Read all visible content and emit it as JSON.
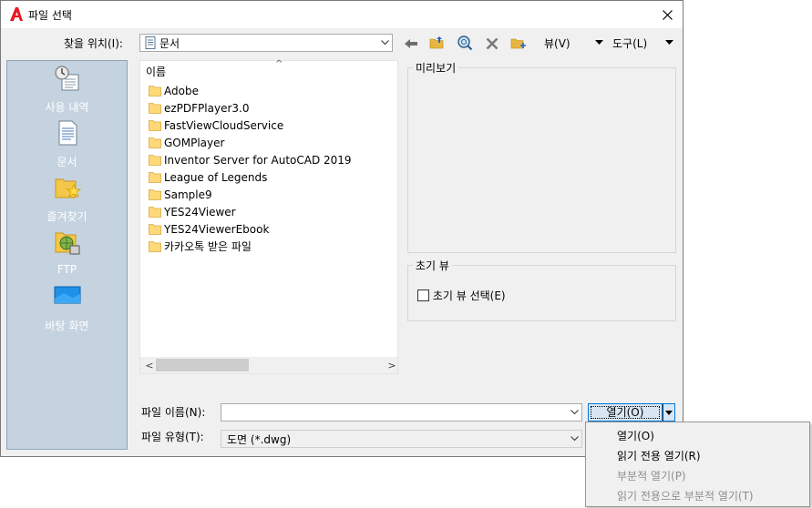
{
  "window": {
    "title": "파일 선택",
    "close_glyph": "✕"
  },
  "toolbar": {
    "lookin_label": "찾을 위치(I):",
    "lookin_value": "문서",
    "views_label": "뷰(V)",
    "tools_label": "도구(L)"
  },
  "places": [
    {
      "label": "사용 내역",
      "icon": "history-icon"
    },
    {
      "label": "문서",
      "icon": "documents-icon"
    },
    {
      "label": "즐겨찾기",
      "icon": "favorites-icon"
    },
    {
      "label": "FTP",
      "icon": "ftp-icon"
    },
    {
      "label": "바탕 화면",
      "icon": "desktop-icon"
    }
  ],
  "filelist": {
    "column_header": "이름",
    "sort_glyph": "^",
    "items": [
      "Adobe",
      "ezPDFPlayer3.0",
      "FastViewCloudService",
      "GOMPlayer",
      "Inventor Server for AutoCAD 2019",
      "League of Legends",
      "Sample9",
      "YES24Viewer",
      "YES24ViewerEbook",
      "카카오톡 받은 파일"
    ]
  },
  "preview": {
    "title": "미리보기"
  },
  "initial_view": {
    "title": "초기 뷰",
    "checkbox_label": "초기 뷰 선택(E)",
    "checked": false
  },
  "form": {
    "filename_label": "파일 이름(N):",
    "filename_value": "",
    "filetype_label": "파일 유형(T):",
    "filetype_value": "도면 (*.dwg)",
    "open_button": "열기(O)"
  },
  "open_menu": [
    {
      "label": "열기(O)",
      "enabled": true
    },
    {
      "label": "읽기 전용 열기(R)",
      "enabled": true
    },
    {
      "label": "부분적 열기(P)",
      "enabled": false
    },
    {
      "label": "읽기 전용으로 부분적 열기(T)",
      "enabled": false
    }
  ],
  "colors": {
    "accent": "#0078d7",
    "sidebar": "#c5d3e0",
    "folder": "#ffd87a",
    "autocad_red": "#e51b23"
  }
}
